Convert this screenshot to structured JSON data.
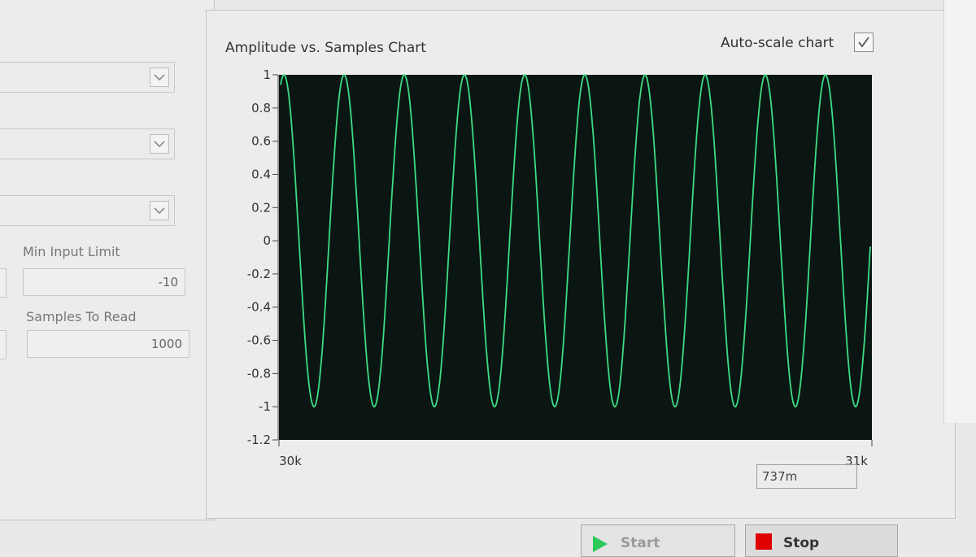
{
  "left_panel": {
    "combos": [
      {
        "value": ""
      },
      {
        "value": ""
      },
      {
        "value": ""
      }
    ],
    "min_input_limit": {
      "label": "Min Input Limit",
      "value": "-10"
    },
    "samples_to_read": {
      "label": "Samples To Read",
      "value": "1000"
    }
  },
  "chart": {
    "title": "Amplitude vs. Samples Chart",
    "autoscale_label": "Auto-scale chart",
    "autoscale_checked": true,
    "cursor_readout": "737m"
  },
  "buttons": {
    "start_label": "Start",
    "stop_label": "Stop"
  },
  "colors": {
    "plot_background": "#0b1613",
    "trace": "#3ddc84",
    "stop_icon": "#e00000",
    "start_icon": "#2ec95a"
  },
  "chart_data": {
    "type": "line",
    "title": "Amplitude vs. Samples Chart",
    "xlabel": "",
    "ylabel": "",
    "xlim": [
      30000,
      31000
    ],
    "ylim": [
      -1.2,
      1.0
    ],
    "x_tick_labels": [
      "30k",
      "31k"
    ],
    "y_ticks": [
      1,
      0.8,
      0.6,
      0.4,
      0.2,
      0,
      -0.2,
      -0.4,
      -0.6,
      -0.8,
      -1,
      -1.2
    ],
    "y_tick_labels": [
      "1",
      "0.8",
      "0.6",
      "0.4",
      "0.2",
      "0",
      "-0.2",
      "-0.4",
      "-0.6",
      "-0.8",
      "-1",
      "-1.2"
    ],
    "series": [
      {
        "waveform": "sine",
        "amplitude": 1.0,
        "cycles_in_view": 9.8,
        "start_phase_deg": 70,
        "color": "#3ddc84"
      }
    ]
  }
}
